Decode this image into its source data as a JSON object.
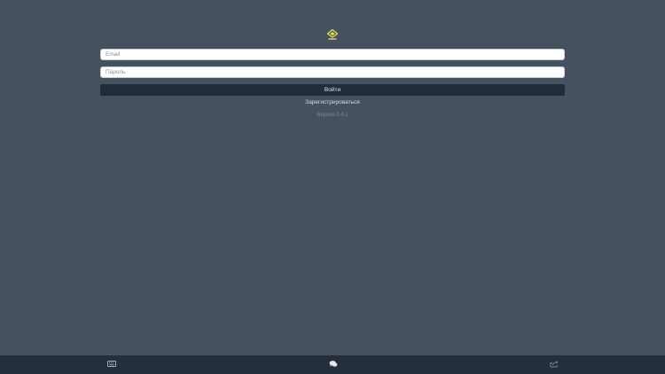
{
  "header": {
    "logo_icon": "crown-diamond-icon",
    "logo_color": "#e8e25a"
  },
  "login_form": {
    "email_placeholder": "Email",
    "password_placeholder": "Пароль",
    "submit_label": "Войти",
    "register_label": "Зарегистрироваться",
    "version_text": "Версия 0.4.1"
  },
  "bottom_bar": {
    "items": [
      {
        "icon": "keyboard-icon"
      },
      {
        "icon": "chat-icon"
      },
      {
        "icon": "share-icon"
      }
    ]
  },
  "colors": {
    "background": "#46515f",
    "button": "#222c39",
    "bottom_bar": "#252f3c"
  }
}
